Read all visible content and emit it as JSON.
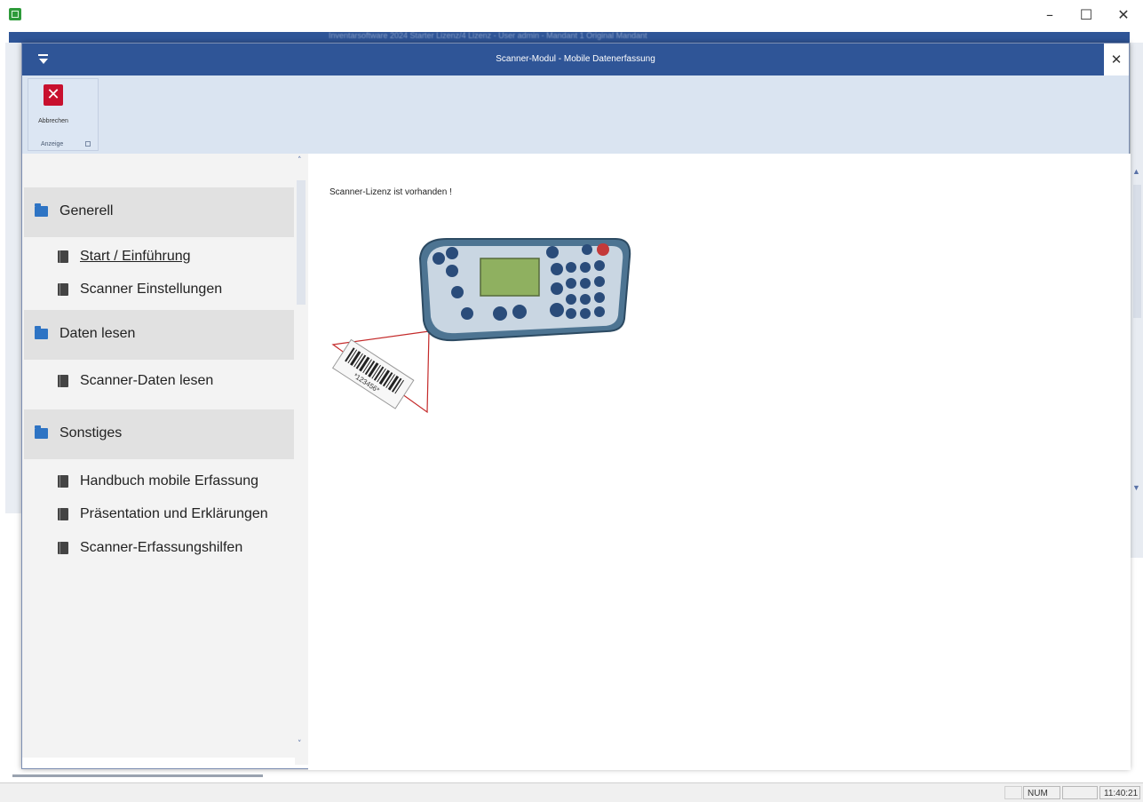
{
  "outer_window": {
    "title_blurred": "Inventarsoftware 2024 Starter Lizenz/4 Lizenz - User admin - Mandant 1 Original Mandant",
    "minimize": "–",
    "maximize": "☐",
    "close": "✕"
  },
  "dialog": {
    "title": "Scanner-Modul - Mobile Datenerfassung",
    "close_glyph": "✕"
  },
  "ribbon": {
    "cancel_label": "Abbrechen",
    "cancel_glyph": "✕",
    "group_label": "Anzeige"
  },
  "sidebar": {
    "sections": [
      {
        "label": "Generell",
        "items": [
          {
            "label": "Start / Einführung",
            "active": true
          },
          {
            "label": "Scanner Einstellungen",
            "active": false
          }
        ]
      },
      {
        "label": "Daten lesen",
        "items": [
          {
            "label": "Scanner-Daten lesen",
            "active": false
          }
        ]
      },
      {
        "label": "Sonstiges",
        "items": [
          {
            "label": "Handbuch mobile Erfassung",
            "active": false
          },
          {
            "label": "Präsentation und Erklärungen",
            "active": false
          },
          {
            "label": "Scanner-Erfassungshilfen",
            "active": false
          }
        ]
      }
    ]
  },
  "content": {
    "license_text": "Scanner-Lizenz ist vorhanden !",
    "barcode_text": "*123456*"
  },
  "statusbar": {
    "num": "NUM",
    "time": "11:40:21"
  },
  "colors": {
    "title_blue": "#2f5597",
    "ribbon_bg": "#dae4f1",
    "cancel_red": "#c8102e",
    "folder_blue": "#2e74c4"
  }
}
